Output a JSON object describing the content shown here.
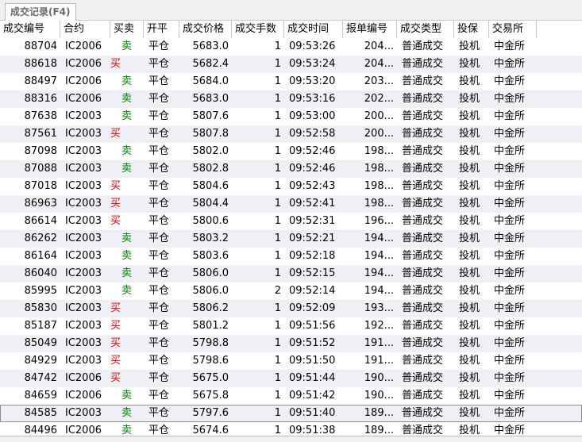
{
  "tab": {
    "label": "成交记录(F4)"
  },
  "columns": [
    "成交编号",
    "合约",
    "买卖",
    "开平",
    "成交价格",
    "成交手数",
    "成交时间",
    "报单编号",
    "成交类型",
    "投保",
    "交易所"
  ],
  "colors": {
    "sell": "#008000",
    "buy": "#e00000"
  },
  "rows": [
    {
      "id": "88704",
      "contract": "IC2006",
      "side": "卖",
      "oc": "平仓",
      "price": "5683.0",
      "qty": "1",
      "time": "09:53:26",
      "order": "204...",
      "type": "普通成交",
      "hedge": "投机",
      "exchange": "中金所"
    },
    {
      "id": "88618",
      "contract": "IC2006",
      "side": "买",
      "oc": "平仓",
      "price": "5682.4",
      "qty": "1",
      "time": "09:53:24",
      "order": "204...",
      "type": "普通成交",
      "hedge": "投机",
      "exchange": "中金所"
    },
    {
      "id": "88497",
      "contract": "IC2006",
      "side": "卖",
      "oc": "平仓",
      "price": "5684.0",
      "qty": "1",
      "time": "09:53:20",
      "order": "203...",
      "type": "普通成交",
      "hedge": "投机",
      "exchange": "中金所"
    },
    {
      "id": "88316",
      "contract": "IC2006",
      "side": "卖",
      "oc": "平仓",
      "price": "5683.0",
      "qty": "1",
      "time": "09:53:16",
      "order": "202...",
      "type": "普通成交",
      "hedge": "投机",
      "exchange": "中金所"
    },
    {
      "id": "87638",
      "contract": "IC2003",
      "side": "卖",
      "oc": "平仓",
      "price": "5807.6",
      "qty": "1",
      "time": "09:53:00",
      "order": "200...",
      "type": "普通成交",
      "hedge": "投机",
      "exchange": "中金所"
    },
    {
      "id": "87561",
      "contract": "IC2003",
      "side": "买",
      "oc": "平仓",
      "price": "5807.8",
      "qty": "1",
      "time": "09:52:58",
      "order": "200...",
      "type": "普通成交",
      "hedge": "投机",
      "exchange": "中金所"
    },
    {
      "id": "87098",
      "contract": "IC2003",
      "side": "卖",
      "oc": "平仓",
      "price": "5802.0",
      "qty": "1",
      "time": "09:52:46",
      "order": "198...",
      "type": "普通成交",
      "hedge": "投机",
      "exchange": "中金所"
    },
    {
      "id": "87088",
      "contract": "IC2003",
      "side": "卖",
      "oc": "平仓",
      "price": "5802.8",
      "qty": "1",
      "time": "09:52:46",
      "order": "198...",
      "type": "普通成交",
      "hedge": "投机",
      "exchange": "中金所"
    },
    {
      "id": "87018",
      "contract": "IC2003",
      "side": "买",
      "oc": "平仓",
      "price": "5804.6",
      "qty": "1",
      "time": "09:52:43",
      "order": "198...",
      "type": "普通成交",
      "hedge": "投机",
      "exchange": "中金所"
    },
    {
      "id": "86963",
      "contract": "IC2003",
      "side": "买",
      "oc": "平仓",
      "price": "5804.4",
      "qty": "1",
      "time": "09:52:41",
      "order": "198...",
      "type": "普通成交",
      "hedge": "投机",
      "exchange": "中金所"
    },
    {
      "id": "86614",
      "contract": "IC2003",
      "side": "买",
      "oc": "平仓",
      "price": "5800.6",
      "qty": "1",
      "time": "09:52:31",
      "order": "196...",
      "type": "普通成交",
      "hedge": "投机",
      "exchange": "中金所"
    },
    {
      "id": "86262",
      "contract": "IC2003",
      "side": "卖",
      "oc": "平仓",
      "price": "5803.2",
      "qty": "1",
      "time": "09:52:21",
      "order": "194...",
      "type": "普通成交",
      "hedge": "投机",
      "exchange": "中金所"
    },
    {
      "id": "86164",
      "contract": "IC2003",
      "side": "卖",
      "oc": "平仓",
      "price": "5803.6",
      "qty": "1",
      "time": "09:52:18",
      "order": "194...",
      "type": "普通成交",
      "hedge": "投机",
      "exchange": "中金所"
    },
    {
      "id": "86040",
      "contract": "IC2003",
      "side": "卖",
      "oc": "平仓",
      "price": "5806.0",
      "qty": "1",
      "time": "09:52:15",
      "order": "194...",
      "type": "普通成交",
      "hedge": "投机",
      "exchange": "中金所"
    },
    {
      "id": "85995",
      "contract": "IC2003",
      "side": "卖",
      "oc": "平仓",
      "price": "5806.0",
      "qty": "2",
      "time": "09:52:14",
      "order": "194...",
      "type": "普通成交",
      "hedge": "投机",
      "exchange": "中金所"
    },
    {
      "id": "85830",
      "contract": "IC2003",
      "side": "买",
      "oc": "平仓",
      "price": "5806.2",
      "qty": "1",
      "time": "09:52:09",
      "order": "193...",
      "type": "普通成交",
      "hedge": "投机",
      "exchange": "中金所"
    },
    {
      "id": "85187",
      "contract": "IC2003",
      "side": "买",
      "oc": "平仓",
      "price": "5801.2",
      "qty": "1",
      "time": "09:51:56",
      "order": "192...",
      "type": "普通成交",
      "hedge": "投机",
      "exchange": "中金所"
    },
    {
      "id": "85049",
      "contract": "IC2003",
      "side": "买",
      "oc": "平仓",
      "price": "5798.8",
      "qty": "1",
      "time": "09:51:52",
      "order": "191...",
      "type": "普通成交",
      "hedge": "投机",
      "exchange": "中金所"
    },
    {
      "id": "84929",
      "contract": "IC2003",
      "side": "买",
      "oc": "平仓",
      "price": "5798.6",
      "qty": "1",
      "time": "09:51:50",
      "order": "191...",
      "type": "普通成交",
      "hedge": "投机",
      "exchange": "中金所"
    },
    {
      "id": "84742",
      "contract": "IC2006",
      "side": "买",
      "oc": "平仓",
      "price": "5675.0",
      "qty": "1",
      "time": "09:51:44",
      "order": "190...",
      "type": "普通成交",
      "hedge": "投机",
      "exchange": "中金所"
    },
    {
      "id": "84659",
      "contract": "IC2006",
      "side": "卖",
      "oc": "平仓",
      "price": "5675.8",
      "qty": "1",
      "time": "09:51:42",
      "order": "190...",
      "type": "普通成交",
      "hedge": "投机",
      "exchange": "中金所"
    },
    {
      "id": "84585",
      "contract": "IC2003",
      "side": "卖",
      "oc": "平仓",
      "price": "5797.6",
      "qty": "1",
      "time": "09:51:40",
      "order": "189...",
      "type": "普通成交",
      "hedge": "投机",
      "exchange": "中金所",
      "selected": true
    },
    {
      "id": "84496",
      "contract": "IC2006",
      "side": "卖",
      "oc": "平仓",
      "price": "5674.6",
      "qty": "1",
      "time": "09:51:38",
      "order": "189...",
      "type": "普通成交",
      "hedge": "投机",
      "exchange": "中金所"
    }
  ]
}
